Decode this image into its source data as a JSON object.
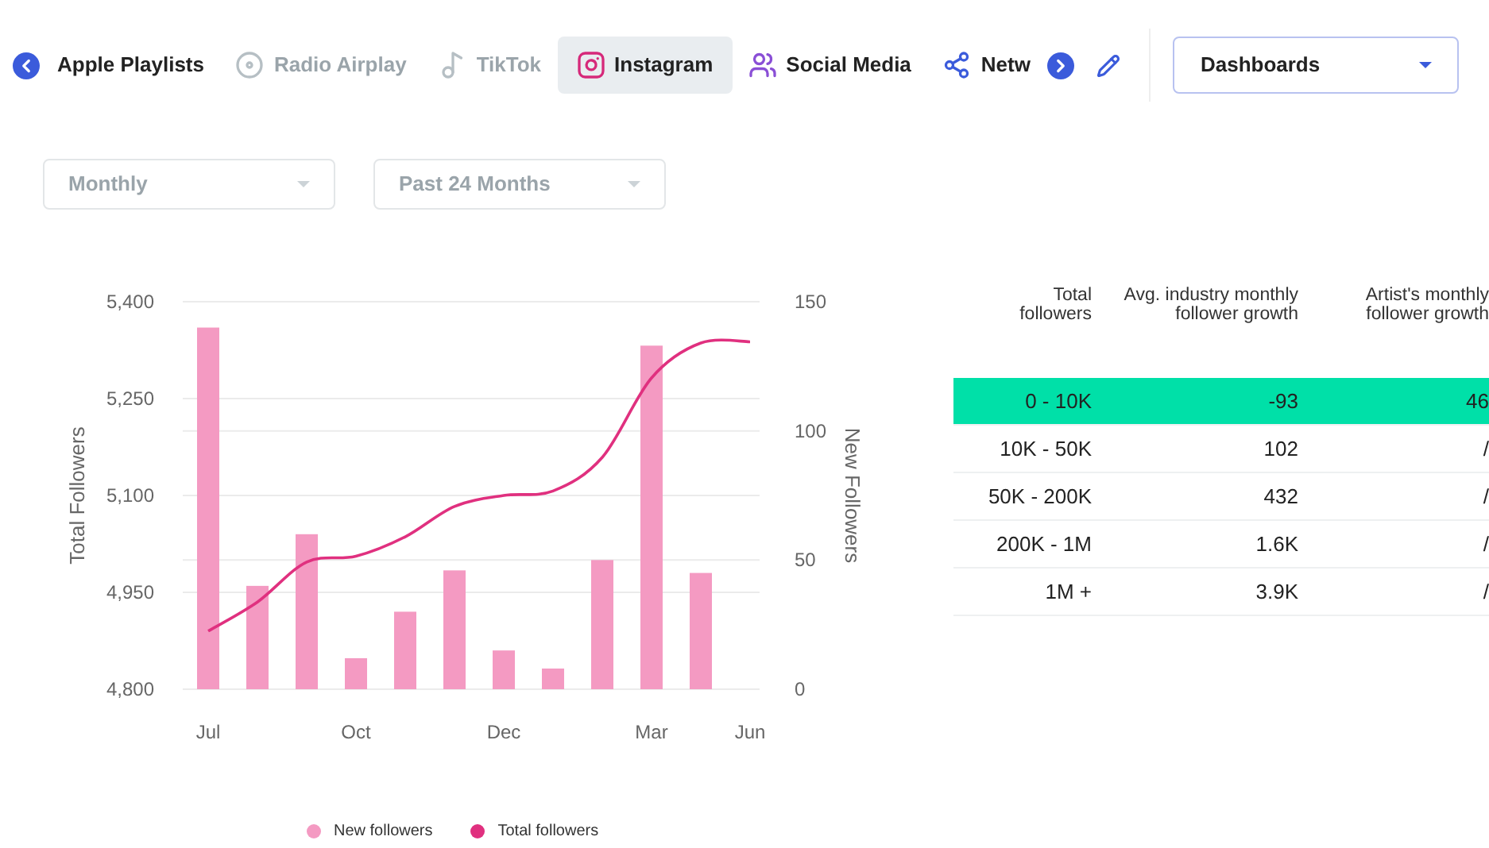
{
  "tabs": [
    {
      "label": "Apple Playlists",
      "kind": "playlists",
      "selected": false,
      "disabled": false
    },
    {
      "label": "Radio Airplay",
      "kind": "radio",
      "selected": false,
      "disabled": true
    },
    {
      "label": "TikTok",
      "kind": "tiktok",
      "selected": false,
      "disabled": true
    },
    {
      "label": "Instagram",
      "kind": "instagram",
      "selected": true,
      "disabled": false
    },
    {
      "label": "Social Media",
      "kind": "social",
      "selected": false,
      "disabled": false
    },
    {
      "label": "Netw",
      "kind": "network",
      "selected": false,
      "disabled": false
    }
  ],
  "dashboards": {
    "value": "Dashboards"
  },
  "filters": [
    {
      "value": "Monthly",
      "disabled": true
    },
    {
      "value": "Past 24 Months",
      "disabled": true
    }
  ],
  "chart": {
    "chart_data": {
      "type": "bar",
      "ylabel": "Total Followers",
      "grid": true,
      "categories": [
        "Jul",
        null,
        null,
        "Oct",
        null,
        null,
        "Dec",
        null,
        null,
        "Mar",
        null,
        "Jun"
      ],
      "ylim": [
        4800,
        5400
      ],
      "yticks": [
        {
          "value": 4800,
          "label": "4,800"
        },
        {
          "value": 4950,
          "label": "4,950"
        },
        {
          "value": 5100,
          "label": "5,100"
        },
        {
          "value": 5250,
          "label": "5,250"
        },
        {
          "value": 5400,
          "label": "5,400"
        }
      ],
      "y2label": "New Followers",
      "y2lim": [
        0,
        150
      ],
      "y2ticks": [
        0,
        50,
        100,
        150
      ],
      "series": [
        {
          "name": "New followers",
          "axis": "y2",
          "color": "#f49ac2",
          "values": [
            140,
            40,
            60,
            12,
            30,
            46,
            15,
            8,
            50,
            133,
            45,
            null
          ]
        },
        {
          "name": "Total followers",
          "type": "line",
          "color": "#e0307f",
          "values": [
            4890,
            4935,
            4997,
            5006,
            5036,
            5083,
            5100,
            5107,
            5159,
            5282,
            5336,
            5338
          ]
        }
      ]
    }
  },
  "table": {
    "columns": [
      "Total followers",
      "Avg. industry monthly follower growth",
      "Artist's monthly follower growth"
    ],
    "rows": [
      {
        "cells": [
          "0 - 10K",
          "-93",
          "46"
        ],
        "selected": true
      },
      {
        "cells": [
          "10K - 50K",
          "102",
          "/"
        ],
        "selected": false
      },
      {
        "cells": [
          "50K - 200K",
          "432",
          "/"
        ],
        "selected": false
      },
      {
        "cells": [
          "200K - 1M",
          "1.6K",
          "/"
        ],
        "selected": false
      },
      {
        "cells": [
          "1M +",
          "3.9K",
          "/"
        ],
        "selected": false
      }
    ]
  }
}
